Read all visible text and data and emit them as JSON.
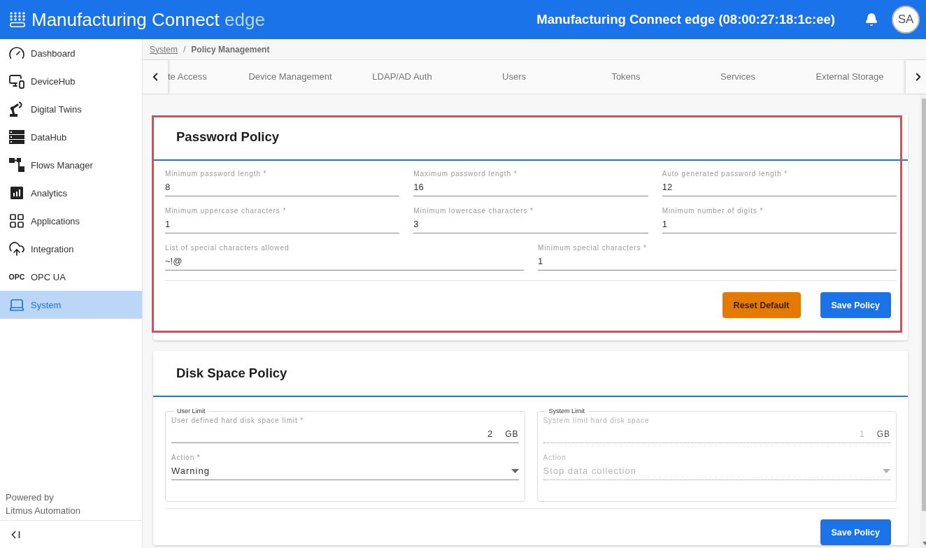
{
  "header": {
    "brand": "Manufacturing Connect",
    "brand_suffix": "edge",
    "device_title": "Manufacturing Connect edge (08:00:27:18:1c:ee)",
    "avatar": "SA"
  },
  "sidebar": {
    "items": [
      {
        "label": "Dashboard",
        "selected": false
      },
      {
        "label": "DeviceHub",
        "selected": false
      },
      {
        "label": "Digital Twins",
        "selected": false
      },
      {
        "label": "DataHub",
        "selected": false
      },
      {
        "label": "Flows Manager",
        "selected": false
      },
      {
        "label": "Analytics",
        "selected": false
      },
      {
        "label": "Applications",
        "selected": false
      },
      {
        "label": "Integration",
        "selected": false
      },
      {
        "label": "OPC UA",
        "selected": false,
        "badge": "OPC"
      },
      {
        "label": "System",
        "selected": true
      }
    ],
    "footer_lines": [
      "Powered by",
      "Litmus Automation"
    ]
  },
  "breadcrumb": {
    "items": [
      {
        "label": "System",
        "kind": "link"
      },
      {
        "label": "Policy Management",
        "kind": "current"
      }
    ],
    "separator": "/"
  },
  "tabs": [
    {
      "label": "te Access",
      "selected": false
    },
    {
      "label": "Device Management",
      "selected": false
    },
    {
      "label": "LDAP/AD Auth",
      "selected": false
    },
    {
      "label": "Users",
      "selected": false
    },
    {
      "label": "Tokens",
      "selected": false
    },
    {
      "label": "Services",
      "selected": false
    },
    {
      "label": "External Storage",
      "selected": false
    }
  ],
  "password_policy": {
    "title": "Password Policy",
    "highlighted": true,
    "rows": [
      [
        {
          "label": "Minimum password length *",
          "value": "8"
        },
        {
          "label": "Maximum password length *",
          "value": "16"
        },
        {
          "label": "Auto generated password length *",
          "value": "12"
        }
      ],
      [
        {
          "label": "Minimum uppercase characters *",
          "value": "1"
        },
        {
          "label": "Minimum lowercase characters *",
          "value": "3"
        },
        {
          "label": "Minimum number of digits *",
          "value": "1"
        }
      ],
      [
        {
          "label": "List of special characters allowed",
          "value": "~!@"
        },
        {
          "label": "Minimum special characters *",
          "value": "1"
        }
      ]
    ],
    "buttons": [
      {
        "label": "Reset Default",
        "kind": "secondary"
      },
      {
        "label": "Save Policy",
        "kind": "primary"
      }
    ]
  },
  "disk_space_policy": {
    "title": "Disk Space Policy",
    "groups": [
      {
        "legend": "User Limit",
        "disabled": false,
        "limit": {
          "label": "User defined hard disk space limit *",
          "value": "2",
          "unit": "GB"
        },
        "action": {
          "label": "Action *",
          "value": "Warning"
        }
      },
      {
        "legend": "System Limit",
        "disabled": true,
        "limit": {
          "label": "System limit hard disk space",
          "value": "1",
          "unit": "GB"
        },
        "action": {
          "label": "Action",
          "value": "Stop data collection"
        }
      }
    ],
    "buttons": [
      {
        "label": "Save Policy",
        "kind": "primary"
      }
    ]
  }
}
